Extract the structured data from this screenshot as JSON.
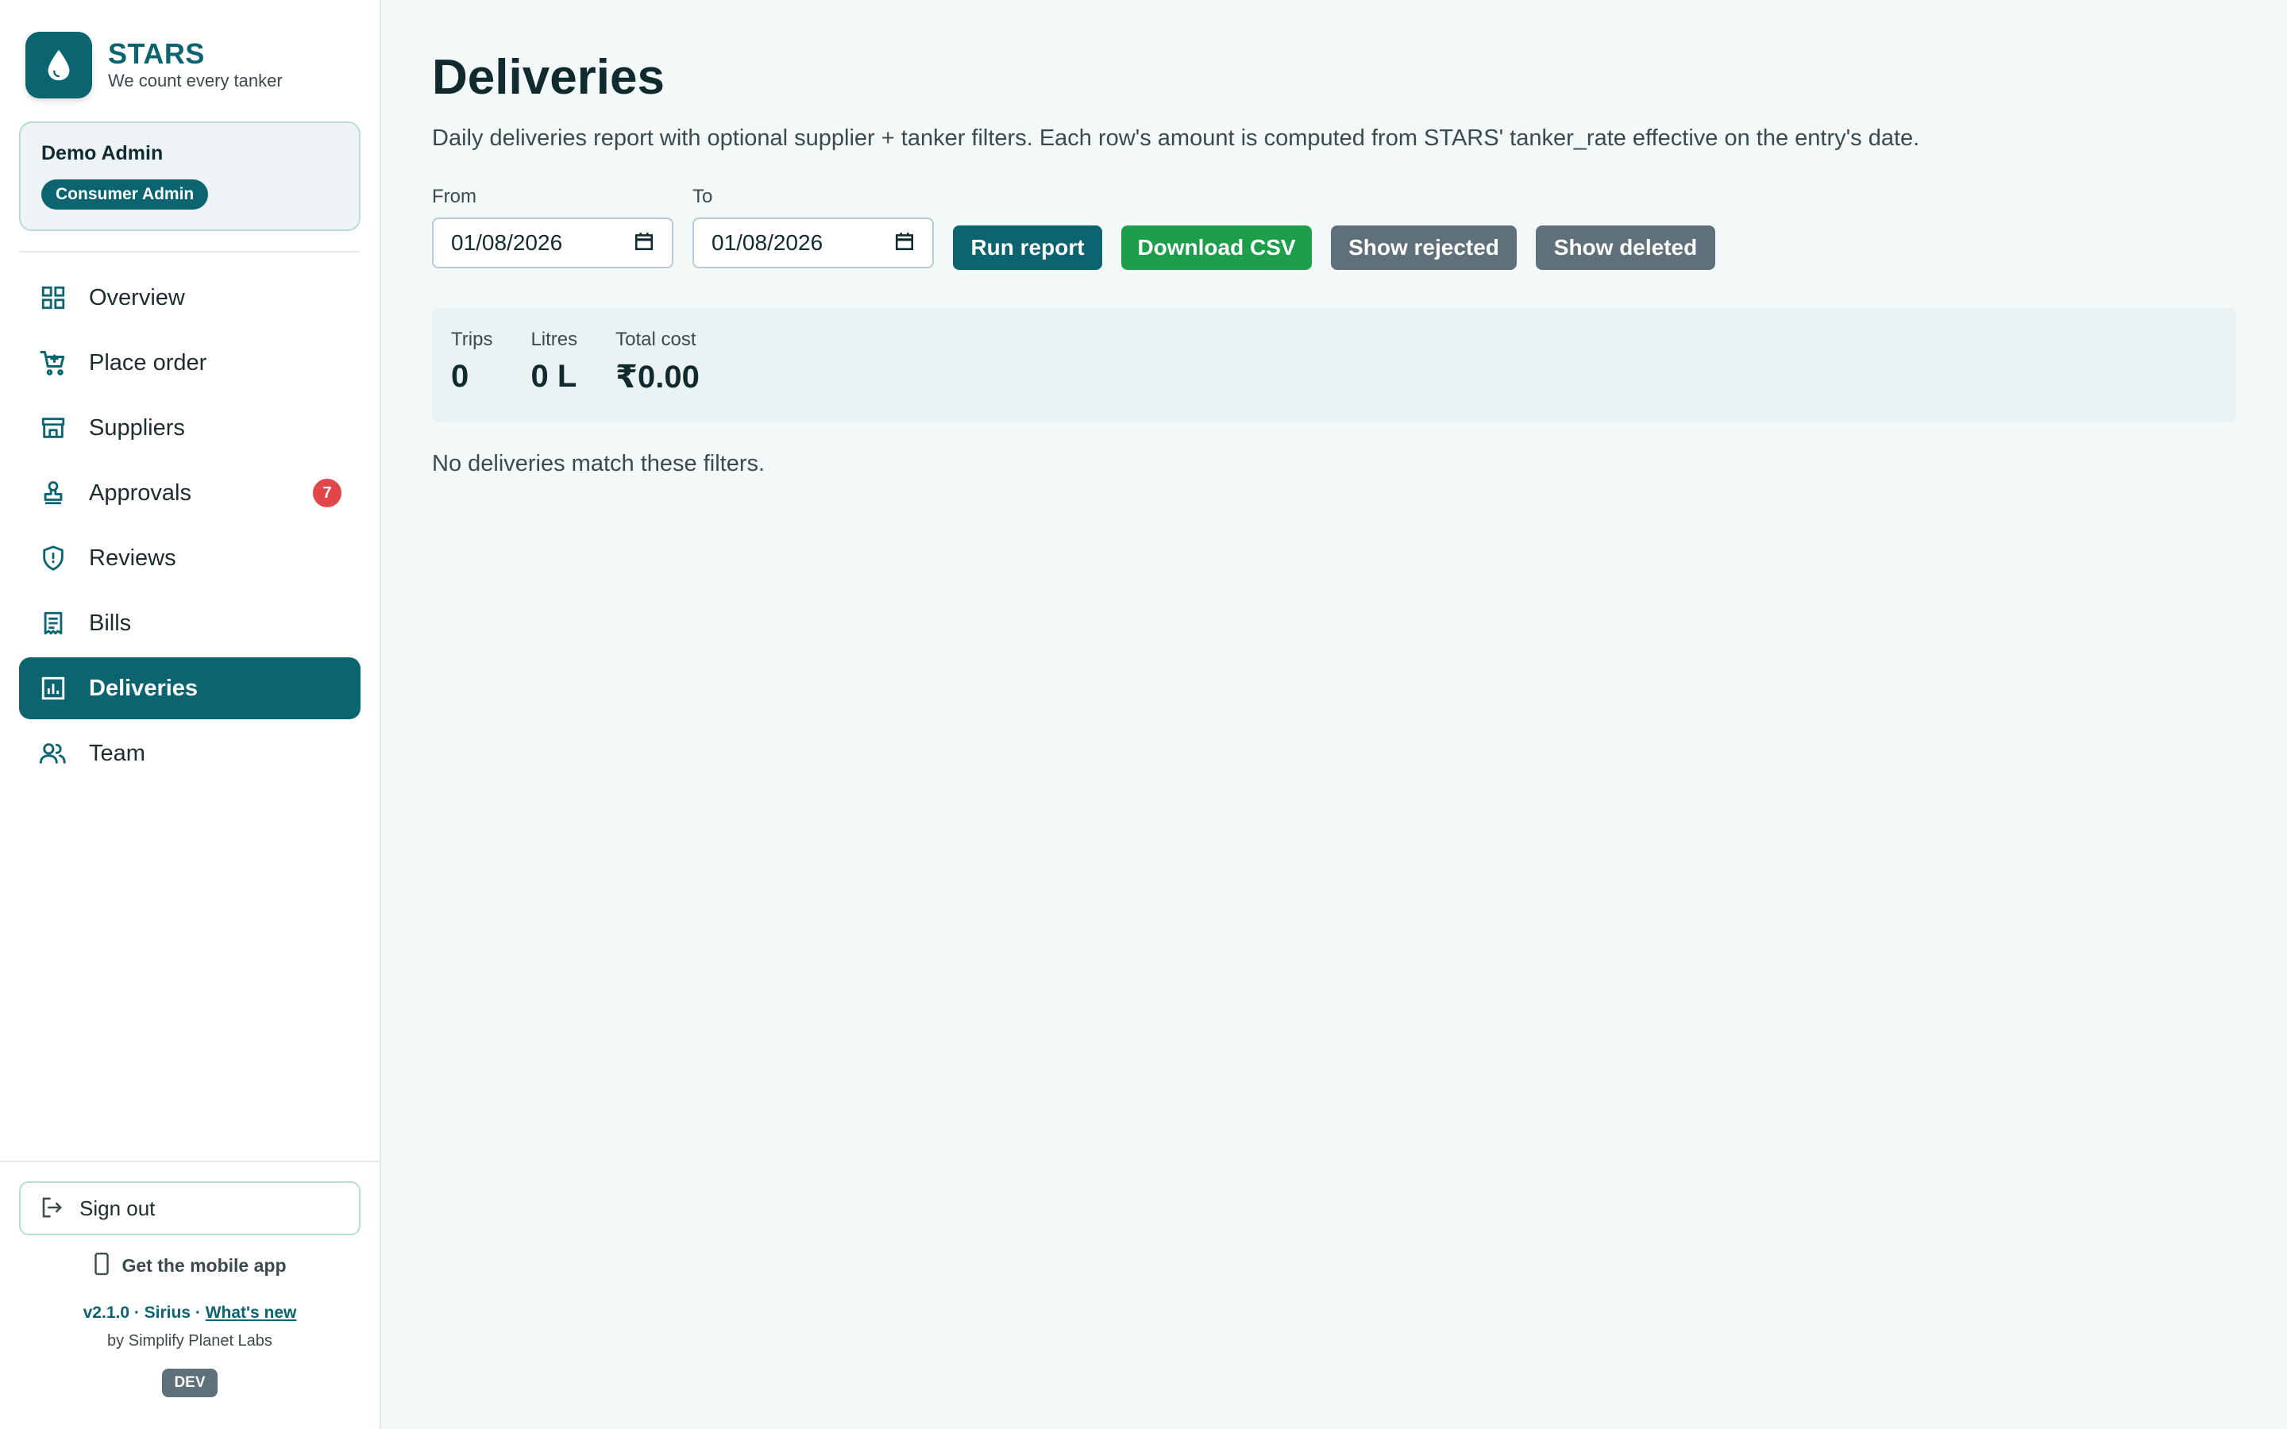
{
  "brand": {
    "name": "STARS",
    "tagline": "We count every tanker"
  },
  "user": {
    "name": "Demo Admin",
    "role": "Consumer Admin"
  },
  "nav": {
    "items": [
      {
        "label": "Overview",
        "icon": "grid-icon"
      },
      {
        "label": "Place order",
        "icon": "cart-icon"
      },
      {
        "label": "Suppliers",
        "icon": "store-icon"
      },
      {
        "label": "Approvals",
        "icon": "stamp-icon",
        "badge": "7"
      },
      {
        "label": "Reviews",
        "icon": "shield-icon"
      },
      {
        "label": "Bills",
        "icon": "receipt-icon"
      },
      {
        "label": "Deliveries",
        "icon": "bar-chart-icon",
        "active": true
      },
      {
        "label": "Team",
        "icon": "people-icon"
      }
    ]
  },
  "footer": {
    "signout": "Sign out",
    "mobile_app": "Get the mobile app",
    "version": "v2.1.0 · Sirius · ",
    "whats_new": "What's new",
    "maker": "by Simplify Planet Labs",
    "env": "DEV"
  },
  "page": {
    "title": "Deliveries",
    "description": "Daily deliveries report with optional supplier + tanker filters. Each row's amount is computed from STARS' tanker_rate effective on the entry's date."
  },
  "filters": {
    "from_label": "From",
    "from_value": "01/08/2026",
    "to_label": "To",
    "to_value": "01/08/2026"
  },
  "actions": {
    "run": "Run report",
    "csv": "Download CSV",
    "rejected": "Show rejected",
    "deleted": "Show deleted"
  },
  "summary": {
    "trips_label": "Trips",
    "trips_value": "0",
    "litres_label": "Litres",
    "litres_value": "0 L",
    "cost_label": "Total cost",
    "cost_value": "₹0.00"
  },
  "empty_message": "No deliveries match these filters.",
  "colors": {
    "brand": "#0b6470",
    "success": "#1d9e4b",
    "neutral": "#5f707a",
    "alert": "#e0464a"
  }
}
